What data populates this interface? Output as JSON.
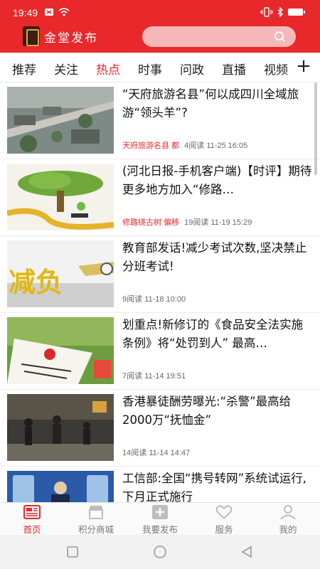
{
  "statusbar": {
    "time": "19:49"
  },
  "app": {
    "name": "金堂发布",
    "brand_color": "#e8282b"
  },
  "search": {
    "placeholder": ""
  },
  "tabs": [
    {
      "label": "推荐",
      "active": false
    },
    {
      "label": "关注",
      "active": false
    },
    {
      "label": "热点",
      "active": true
    },
    {
      "label": "时事",
      "active": false
    },
    {
      "label": "问政",
      "active": false
    },
    {
      "label": "直播",
      "active": false
    },
    {
      "label": "视频",
      "active": false
    }
  ],
  "tab_plus": "+",
  "news": [
    {
      "title": "“天府旅游名县”何以成四川全域旅游“领头羊”?",
      "tag": "天府旅游名县 都",
      "reads": "4阅读",
      "time": "11-25 16:05"
    },
    {
      "title": "(河北日报-手机客户端)【时评】期待更多地方加入“修路…",
      "tag": "修路绕古树 偏移",
      "reads": "19阅读",
      "time": "11-19 15:29"
    },
    {
      "title": "教育部发话!减少考试次数,坚决禁止分班考试!",
      "tag": "",
      "reads": "9阅读",
      "time": "11-18 10:00"
    },
    {
      "title": "划重点!新修订的《食品安全法实施条例》将“处罚到人” 最高…",
      "tag": "",
      "reads": "7阅读",
      "time": "11-14 19:51"
    },
    {
      "title": "香港暴徒酬劳曝光:“杀警”最高给2000万“抚恤金”",
      "tag": "",
      "reads": "14阅读",
      "time": "11-14 14:47"
    },
    {
      "title": "工信部:全国“携号转网”系统试运行,下月正式施行",
      "tag": "",
      "reads": "",
      "time": ""
    }
  ],
  "thumb_text": {
    "jianfu": "减负"
  },
  "bottom_nav": [
    {
      "label": "首页",
      "icon": "news-icon",
      "active": true
    },
    {
      "label": "积分商城",
      "icon": "shop-icon",
      "active": false
    },
    {
      "label": "我要发布",
      "icon": "add-post-icon",
      "active": false
    },
    {
      "label": "服务",
      "icon": "heart-icon",
      "active": false
    },
    {
      "label": "我的",
      "icon": "profile-icon",
      "active": false
    }
  ]
}
